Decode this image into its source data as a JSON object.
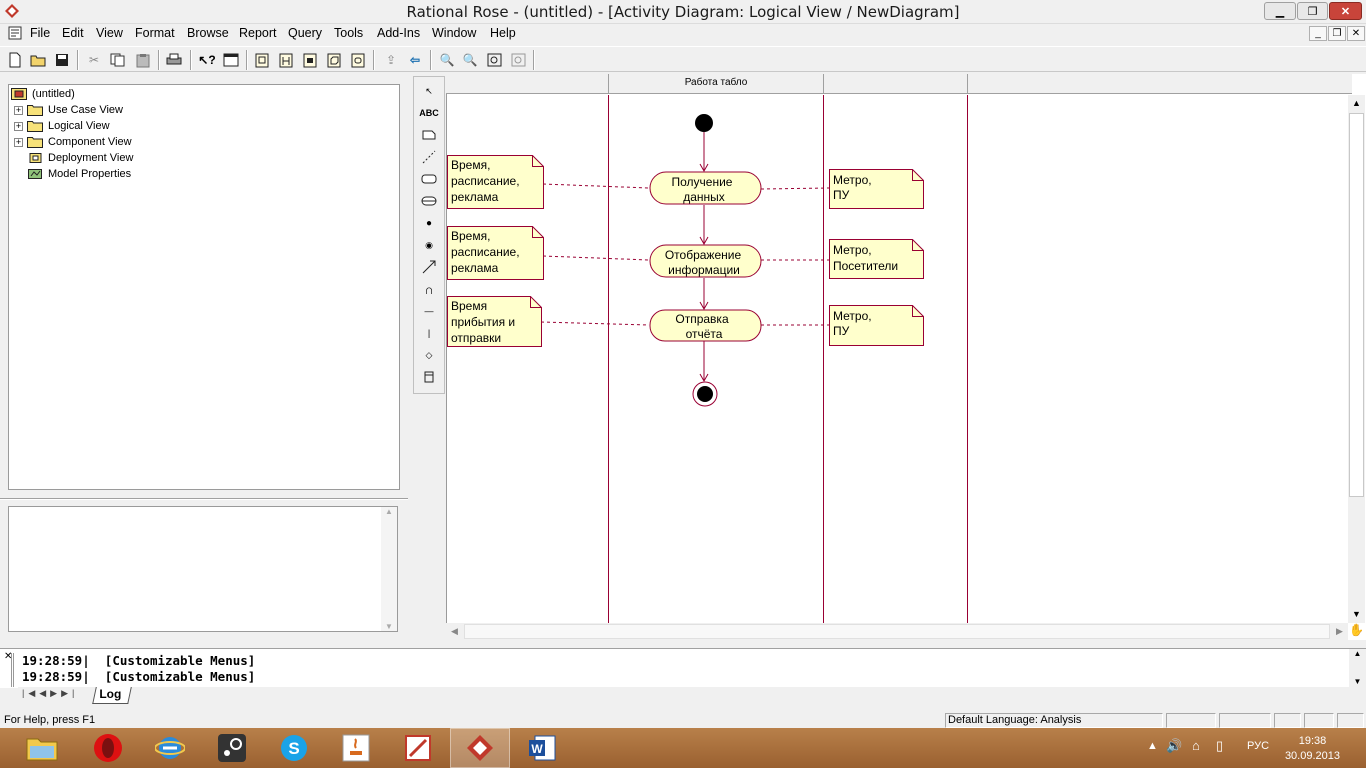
{
  "window": {
    "title": "Rational Rose - (untitled) - [Activity Diagram: Logical View / NewDiagram]"
  },
  "menu": [
    "File",
    "Edit",
    "View",
    "Format",
    "Browse",
    "Report",
    "Query",
    "Tools",
    "Add-Ins",
    "Window",
    "Help"
  ],
  "tree": {
    "root": "(untitled)",
    "items": [
      "Use Case View",
      "Logical View",
      "Component View",
      "Deployment View",
      "Model Properties"
    ]
  },
  "diagram": {
    "swimlane": "Работа табло",
    "activities": [
      {
        "line1": "Получение",
        "line2": "данных"
      },
      {
        "line1": "Отображение",
        "line2": "информации"
      },
      {
        "line1": "Отправка",
        "line2": "отчёта"
      }
    ],
    "left_notes": [
      [
        "Время,",
        "расписание,",
        "реклама"
      ],
      [
        "Время,",
        "расписание,",
        "реклама"
      ],
      [
        "Время",
        "прибытия и",
        "отправки"
      ]
    ],
    "right_notes": [
      [
        "Метро,",
        "ПУ"
      ],
      [
        "Метро,",
        "Посетители"
      ],
      [
        "Метро,",
        "ПУ"
      ]
    ],
    "colors": {
      "activity_fill": "#ffffcc",
      "border": "#990033",
      "lane": "#990033"
    }
  },
  "log": {
    "lines": [
      {
        "time": "19:28:59|",
        "msg": "[Customizable Menus]"
      },
      {
        "time": "19:28:59|",
        "msg": "[Customizable Menus]"
      }
    ],
    "tab": "Log"
  },
  "status": {
    "help": "For Help, press F1",
    "language": "Default Language: Analysis"
  },
  "taskbar": {
    "apps": [
      "explorer-icon",
      "opera-icon",
      "ie-icon",
      "steam-icon",
      "skype-icon",
      "java-icon",
      "rose-red-icon",
      "rational-rose-icon",
      "word-icon"
    ],
    "lang": "РУС",
    "time": "19:38",
    "date": "30.09.2013"
  }
}
